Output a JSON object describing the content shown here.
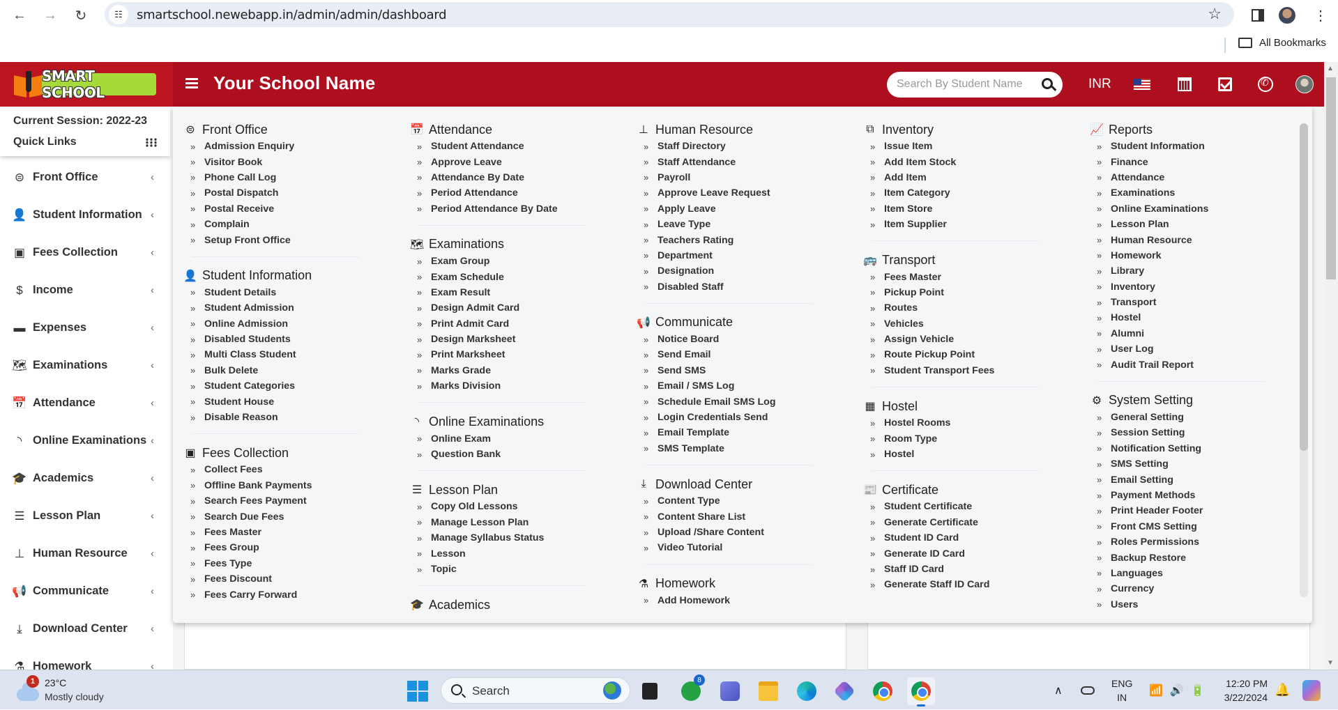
{
  "browser": {
    "url": "smartschool.newebapp.in/admin/admin/dashboard",
    "bookmarks_label": "All Bookmarks"
  },
  "header": {
    "logo_text": "SMART SCHOOL",
    "school_name": "Your School Name",
    "search_placeholder": "Search By Student Name",
    "currency": "INR",
    "colors": {
      "header_bg": "#ad0f1f",
      "logo_bg": "#bd1422",
      "logo_label": "#a6d93a"
    }
  },
  "sidebar": {
    "session": "Current Session: 2022-23",
    "quick_links": "Quick Links",
    "items": [
      {
        "label": "Front Office",
        "icon": "front-office-icon"
      },
      {
        "label": "Student Information",
        "icon": "user-plus-icon"
      },
      {
        "label": "Fees Collection",
        "icon": "money-icon"
      },
      {
        "label": "Income",
        "icon": "dollar-icon"
      },
      {
        "label": "Expenses",
        "icon": "credit-card-icon"
      },
      {
        "label": "Examinations",
        "icon": "map-icon"
      },
      {
        "label": "Attendance",
        "icon": "calendar-check-icon"
      },
      {
        "label": "Online Examinations",
        "icon": "rss-icon"
      },
      {
        "label": "Academics",
        "icon": "graduation-cap-icon"
      },
      {
        "label": "Lesson Plan",
        "icon": "list-alt-icon"
      },
      {
        "label": "Human Resource",
        "icon": "sitemap-icon"
      },
      {
        "label": "Communicate",
        "icon": "bullhorn-icon"
      },
      {
        "label": "Download Center",
        "icon": "download-icon"
      },
      {
        "label": "Homework",
        "icon": "flask-icon"
      }
    ]
  },
  "mega_menu": {
    "columns": [
      {
        "groups": [
          {
            "title": "Front Office",
            "icon": "front-office-icon",
            "items": [
              "Admission Enquiry",
              "Visitor Book",
              "Phone Call Log",
              "Postal Dispatch",
              "Postal Receive",
              "Complain",
              "Setup Front Office"
            ]
          },
          {
            "title": "Student Information",
            "icon": "user-plus-icon",
            "items": [
              "Student Details",
              "Student Admission",
              "Online Admission",
              "Disabled Students",
              "Multi Class Student",
              "Bulk Delete",
              "Student Categories",
              "Student House",
              "Disable Reason"
            ]
          },
          {
            "title": "Fees Collection",
            "icon": "money-icon",
            "items": [
              "Collect Fees",
              "Offline Bank Payments",
              "Search Fees Payment",
              "Search Due Fees",
              "Fees Master",
              "Fees Group",
              "Fees Type",
              "Fees Discount",
              "Fees Carry Forward"
            ]
          }
        ]
      },
      {
        "groups": [
          {
            "title": "Attendance",
            "icon": "calendar-check-icon",
            "items": [
              "Student Attendance",
              "Approve Leave",
              "Attendance By Date",
              "Period Attendance",
              "Period Attendance By Date"
            ]
          },
          {
            "title": "Examinations",
            "icon": "map-icon",
            "items": [
              "Exam Group",
              "Exam Schedule",
              "Exam Result",
              "Design Admit Card",
              "Print Admit Card",
              "Design Marksheet",
              "Print Marksheet",
              "Marks Grade",
              "Marks Division"
            ]
          },
          {
            "title": "Online Examinations",
            "icon": "rss-icon",
            "items": [
              "Online Exam",
              "Question Bank"
            ]
          },
          {
            "title": "Lesson Plan",
            "icon": "list-alt-icon",
            "items": [
              "Copy Old Lessons",
              "Manage Lesson Plan",
              "Manage Syllabus Status",
              "Lesson",
              "Topic"
            ]
          },
          {
            "title": "Academics",
            "icon": "graduation-cap-icon",
            "items": []
          }
        ]
      },
      {
        "groups": [
          {
            "title": "Human Resource",
            "icon": "sitemap-icon",
            "items": [
              "Staff Directory",
              "Staff Attendance",
              "Payroll",
              "Approve Leave Request",
              "Apply Leave",
              "Leave Type",
              "Teachers Rating",
              "Department",
              "Designation",
              "Disabled Staff"
            ]
          },
          {
            "title": "Communicate",
            "icon": "bullhorn-icon",
            "items": [
              "Notice Board",
              "Send Email",
              "Send SMS",
              "Email / SMS Log",
              "Schedule Email SMS Log",
              "Login Credentials Send",
              "Email Template",
              "SMS Template"
            ]
          },
          {
            "title": "Download Center",
            "icon": "download-icon",
            "items": [
              "Content Type",
              "Content Share List",
              "Upload /Share Content",
              "Video Tutorial"
            ]
          },
          {
            "title": "Homework",
            "icon": "flask-icon",
            "items": [
              "Add Homework"
            ]
          }
        ]
      },
      {
        "groups": [
          {
            "title": "Inventory",
            "icon": "object-group-icon",
            "items": [
              "Issue Item",
              "Add Item Stock",
              "Add Item",
              "Item Category",
              "Item Store",
              "Item Supplier"
            ]
          },
          {
            "title": "Transport",
            "icon": "bus-icon",
            "items": [
              "Fees Master",
              "Pickup Point",
              "Routes",
              "Vehicles",
              "Assign Vehicle",
              "Route Pickup Point",
              "Student Transport Fees"
            ]
          },
          {
            "title": "Hostel",
            "icon": "building-icon",
            "items": [
              "Hostel Rooms",
              "Room Type",
              "Hostel"
            ]
          },
          {
            "title": "Certificate",
            "icon": "newspaper-icon",
            "items": [
              "Student Certificate",
              "Generate Certificate",
              "Student ID Card",
              "Generate ID Card",
              "Staff ID Card",
              "Generate Staff ID Card"
            ]
          }
        ]
      },
      {
        "groups": [
          {
            "title": "Reports",
            "icon": "line-chart-icon",
            "items": [
              "Student Information",
              "Finance",
              "Attendance",
              "Examinations",
              "Online Examinations",
              "Lesson Plan",
              "Human Resource",
              "Homework",
              "Library",
              "Inventory",
              "Transport",
              "Hostel",
              "Alumni",
              "User Log",
              "Audit Trail Report"
            ]
          },
          {
            "title": "System Setting",
            "icon": "gears-icon",
            "items": [
              "General Setting",
              "Session Setting",
              "Notification Setting",
              "SMS Setting",
              "Email Setting",
              "Payment Methods",
              "Print Header Footer",
              "Front CMS Setting",
              "Roles Permissions",
              "Backup Restore",
              "Languages",
              "Currency",
              "Users"
            ]
          }
        ]
      }
    ]
  },
  "taskbar": {
    "weather_badge": "1",
    "temperature": "23°C",
    "condition": "Mostly cloudy",
    "search_label": "Search",
    "whatsapp_badge": "8",
    "lang_top": "ENG",
    "lang_bottom": "IN",
    "time": "12:20 PM",
    "date": "3/22/2024"
  }
}
